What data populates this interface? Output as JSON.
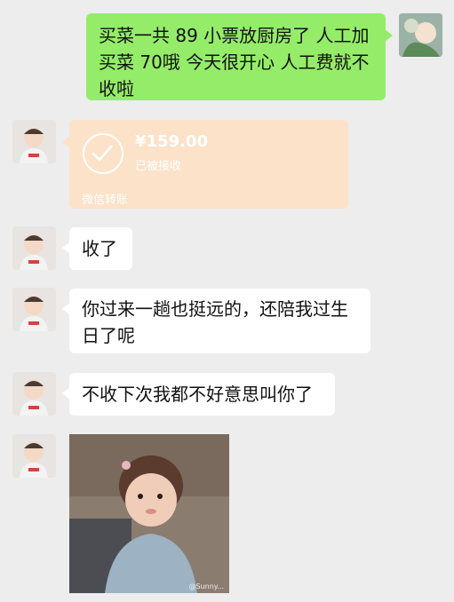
{
  "messages": {
    "m1": "买菜一共 89 小票放厨房了 人工加买菜 70哦 今天很开心 人工费就不收啦",
    "transfer": {
      "amount": "¥159.00",
      "status": "已被接收",
      "label": "微信转账"
    },
    "m2": "收了",
    "m3": "你过来一趟也挺远的，还陪我过生日了呢",
    "m4": "不收下次我都不好意思叫你了"
  },
  "sticker": {
    "watermark": "@Sunny..."
  },
  "colors": {
    "background": "#ededed",
    "my_bubble": "#95ec69",
    "friend_bubble": "#ffffff",
    "transfer_card": "#fbe2c8"
  }
}
